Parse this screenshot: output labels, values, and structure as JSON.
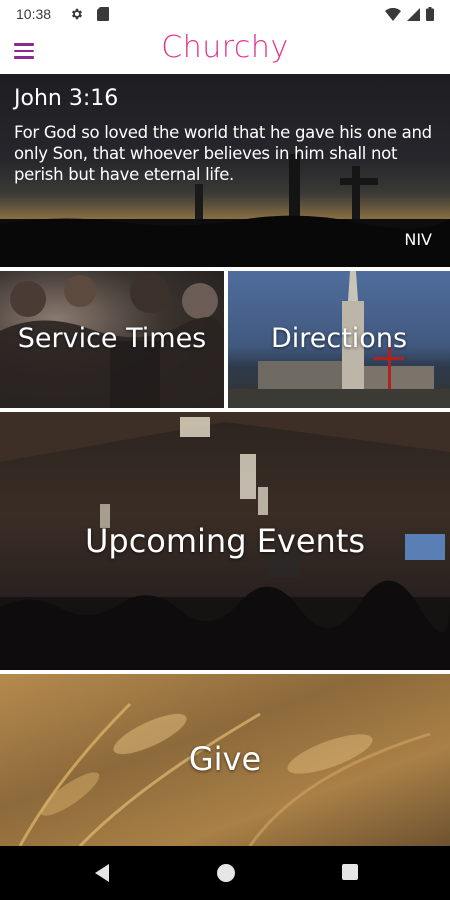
{
  "status": {
    "time": "10:38",
    "icons": [
      "gear-icon",
      "sd-card-icon",
      "wifi-icon",
      "signal-icon",
      "battery-icon"
    ]
  },
  "app_bar": {
    "title": "Churchy",
    "title_color": "#e0348e",
    "menu_color": "#8e2a8c",
    "menu_icon": "hamburger-menu-icon"
  },
  "verse": {
    "reference": "John 3:16",
    "text": "For God so loved the world that he gave his one and only Son, that whoever believes in him shall not perish but have eternal life.",
    "version": "NIV"
  },
  "tiles": {
    "service_times": "Service Times",
    "directions": "Directions",
    "upcoming_events": "Upcoming Events",
    "give": "Give"
  },
  "nav": {
    "back": "back-icon",
    "home": "home-icon",
    "recents": "recents-icon"
  }
}
